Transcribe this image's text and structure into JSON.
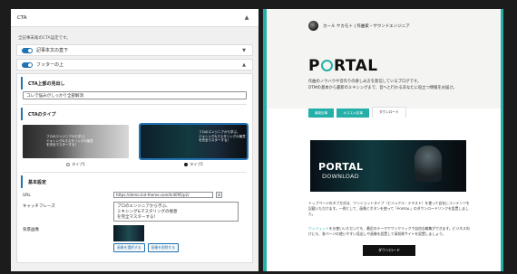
{
  "left_panel": {
    "header_title": "CTA",
    "note": "全記事末尾のCTA設定です。",
    "toggles": [
      {
        "label": "記事本文の直下",
        "on": true
      },
      {
        "label": "フッターの上",
        "on": true
      }
    ],
    "headline_section": "CTA上部の見出し",
    "headline_value": "コレで悩みがしっかり全部解消",
    "type_section": "CTAのタイプ",
    "types": [
      {
        "label": "タイプ1",
        "selected": false,
        "caption": "フロのエンジニアから学ぶ、\nミキシング&マスタリングの極意\nを完全マスターする！"
      },
      {
        "label": "タイプ2",
        "selected": true,
        "caption": "フロのエンジニアから学ぶ、\nミキシング&マスタリングの極意\nを完全マスターする！"
      }
    ],
    "basic_section": "基本設定",
    "url_label": "URL",
    "url_value": "https://demo.tcd-theme.com/tcd095/p2/",
    "catch_label": "キャッチフレーズ",
    "catch_value": "プロのエンジニアから学ぶ、\nミキシング&マスタリングの極意\nを完全マスターする！",
    "bg_label": "背景画像",
    "select_image_button": "画像を選択する",
    "remove_image_button": "画像を削除する"
  },
  "right_panel": {
    "author": "カール ヤカモト | 作曲家・サウンドエンジニア",
    "logo": "PORTAL",
    "description": "作曲のノウハウや音作りの楽しみ方を発信しているブログです。\nDTMの基本から最新のミキシングまで、音へと行わるあなたに役立つ情報をお届け。",
    "tabs": [
      {
        "label": "最新記事",
        "active": false
      },
      {
        "label": "オススメ記事",
        "active": false
      },
      {
        "label": "ダウンロード",
        "active": true
      }
    ],
    "banner_title": "PORTAL",
    "banner_sub": "DOWNLOAD",
    "body_text": "トップページのタブ方式は、ワンショットタイプ（ビジュアル・テキスト）を使って自在にコンテンツを記載いただけます。一例として、画像とボタンを使って「PORTAL」のダウンロードリンクを設置しました。",
    "body_link": "ウィジェット",
    "body_text2": "をお使いいただいても、最近のテーマでワンクリックで自由な編集ができます。ビジネス向けにも、各ページの使いやすい見出しや画像を設置して高効果サイトを設置しましょう。",
    "download_button": "ダウンロード"
  },
  "colors": {
    "accent": "#24b0a8",
    "wp_blue": "#2271b1"
  }
}
